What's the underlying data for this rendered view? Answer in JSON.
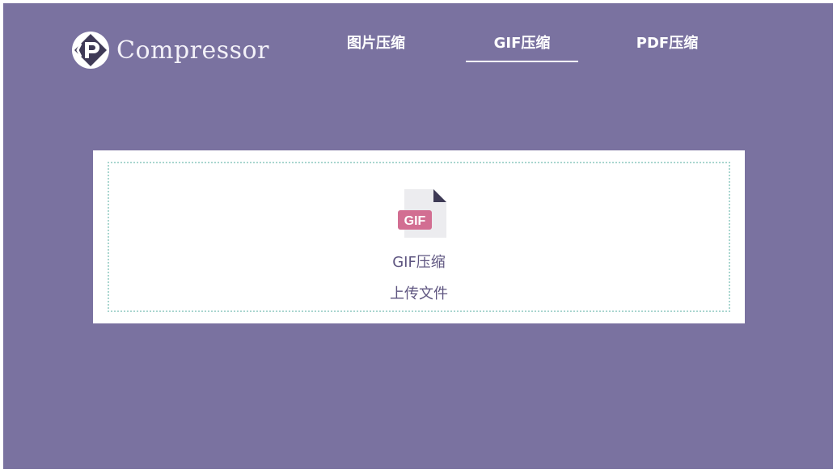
{
  "brand": {
    "name": "Compressor",
    "logo_icon": "compressor-logo-icon"
  },
  "nav": {
    "items": [
      {
        "label": "图片压缩",
        "active": false
      },
      {
        "label": "GIF压缩",
        "active": true
      },
      {
        "label": "PDF压缩",
        "active": false
      }
    ]
  },
  "upload": {
    "icon": "gif-file-icon",
    "file_badge": "GIF",
    "title": "GIF压缩",
    "action": "上传文件"
  },
  "colors": {
    "background": "#7a72a0",
    "badge": "#d26e92",
    "text": "#5e5580",
    "dashed_border": "#a9d6cf"
  }
}
